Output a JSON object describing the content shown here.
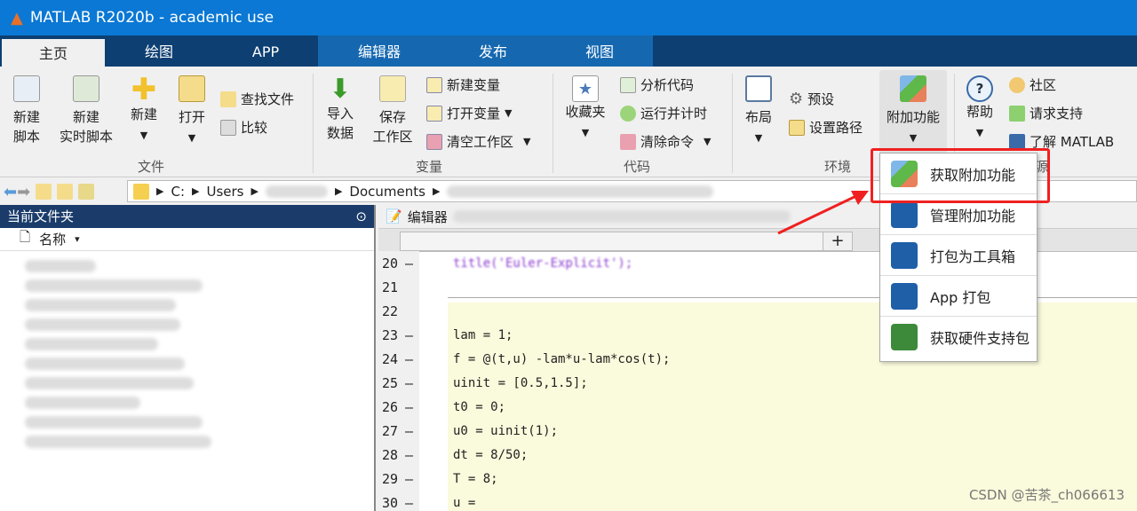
{
  "window": {
    "title": "MATLAB R2020b - academic use"
  },
  "tabs": [
    "主页",
    "绘图",
    "APP",
    "编辑器",
    "发布",
    "视图"
  ],
  "ribbon": {
    "file": {
      "group": "文件",
      "new_script": [
        "新建",
        "脚本"
      ],
      "new_live_script": [
        "新建",
        "实时脚本"
      ],
      "new": "新建",
      "open": "打开",
      "find_files": "查找文件",
      "compare": "比较"
    },
    "variable": {
      "group": "变量",
      "import": [
        "导入",
        "数据"
      ],
      "save": [
        "保存",
        "工作区"
      ],
      "new_var": "新建变量",
      "open_var": "打开变量",
      "clear_ws": "清空工作区"
    },
    "code": {
      "group": "代码",
      "favorites": "收藏夹",
      "analyze": "分析代码",
      "run_time": "运行并计时",
      "clear_cmd": "清除命令"
    },
    "environment": {
      "group": "环境",
      "layout": "布局",
      "prefs": "预设",
      "set_path": "设置路径",
      "addons": "附加功能"
    },
    "resources": {
      "group": "资源",
      "help": "帮助",
      "community": "社区",
      "support": "请求支持",
      "learn": "了解 MATLAB"
    }
  },
  "address": {
    "segments": [
      "C:",
      "Users",
      "Documents"
    ]
  },
  "left_panel": {
    "title": "当前文件夹",
    "column": "名称"
  },
  "editor": {
    "title": "编辑器",
    "lines": [
      {
        "n": "20",
        "dash": true,
        "code": "title('Euler-Explicit');"
      },
      {
        "n": "21",
        "dash": false,
        "code": ""
      },
      {
        "n": "22",
        "dash": false,
        "code": ""
      },
      {
        "n": "23",
        "dash": true,
        "code": "lam = 1;"
      },
      {
        "n": "24",
        "dash": true,
        "code": "f = @(t,u) -lam*u-lam*cos(t);"
      },
      {
        "n": "25",
        "dash": true,
        "code": "uinit = [0.5,1.5];"
      },
      {
        "n": "26",
        "dash": true,
        "code": "t0 = 0;"
      },
      {
        "n": "27",
        "dash": true,
        "code": "u0 = uinit(1);"
      },
      {
        "n": "28",
        "dash": true,
        "code": "dt = 8/50;"
      },
      {
        "n": "29",
        "dash": true,
        "code": "T = 8;"
      },
      {
        "n": "30",
        "dash": true,
        "code": "u = "
      }
    ]
  },
  "addon_menu": [
    "获取附加功能",
    "管理附加功能",
    "打包为工具箱",
    "App 打包",
    "获取硬件支持包"
  ],
  "watermark": "CSDN @苦茶_ch066613"
}
